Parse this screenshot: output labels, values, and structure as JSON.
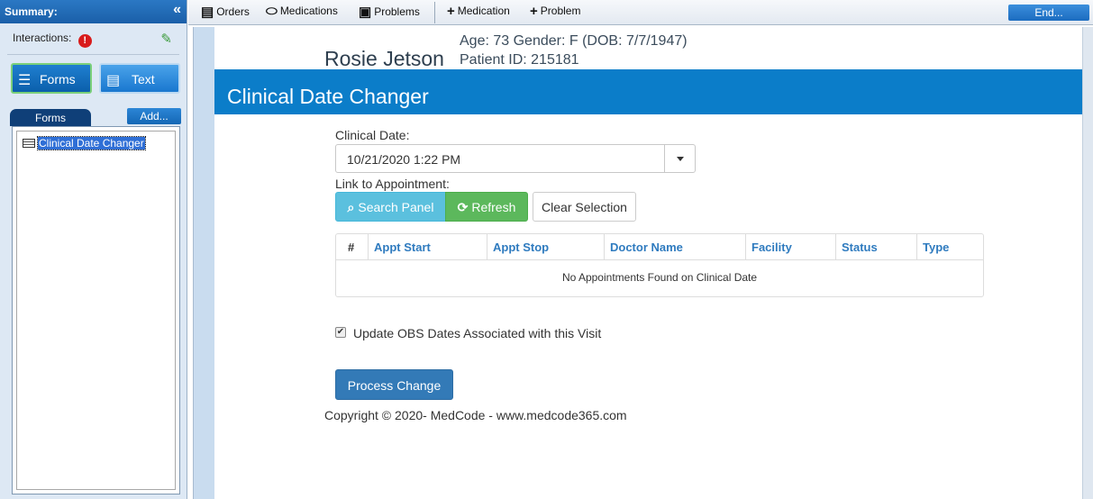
{
  "sidebar": {
    "header_title": "Summary:",
    "collapse_glyph": "«",
    "interactions_label": "Interactions:",
    "alert_glyph": "!",
    "edit_glyph": "✎",
    "forms_button": "Forms",
    "text_button": "Text",
    "forms_tab": "Forms",
    "add_button": "Add...",
    "form_items": [
      "Clinical Date Changer"
    ]
  },
  "toolbar": {
    "items": [
      {
        "label": "Orders",
        "icon": "clipboard-icon"
      },
      {
        "label": "Medications",
        "icon": "pills-icon"
      },
      {
        "label": "Problems",
        "icon": "medical-kit-icon"
      },
      {
        "label": "Medication",
        "icon": "plus-icon"
      },
      {
        "label": "Problem",
        "icon": "plus-icon"
      }
    ],
    "end_button": "End..."
  },
  "patient": {
    "name": "Rosie Jetson",
    "demographics": "Age: 73 Gender: F (DOB: 7/7/1947)",
    "id_line": "Patient ID: 215181"
  },
  "form": {
    "title": "Clinical Date Changer",
    "clinical_date_label": "Clinical Date:",
    "clinical_date_value": "10/21/2020 1:22 PM",
    "link_label": "Link to Appointment:",
    "search_button": "Search Panel",
    "refresh_button": "Refresh",
    "clear_button": "Clear Selection",
    "table": {
      "columns": [
        "#",
        "Appt Start",
        "Appt Stop",
        "Doctor Name",
        "Facility",
        "Status",
        "Type"
      ],
      "empty_message": "No Appointments Found on Clinical Date"
    },
    "obs_checkbox_label": "Update OBS Dates Associated with this Visit",
    "obs_checked": true,
    "process_button": "Process Change",
    "copyright": "Copyright © 2020- MedCode - www.medcode365.com"
  },
  "colors": {
    "title_bar": "#0b7dc9",
    "search_button": "#5bc0de",
    "refresh_button": "#5cb85c",
    "process_button": "#337ab7",
    "table_header_text": "#2f7bbf"
  }
}
